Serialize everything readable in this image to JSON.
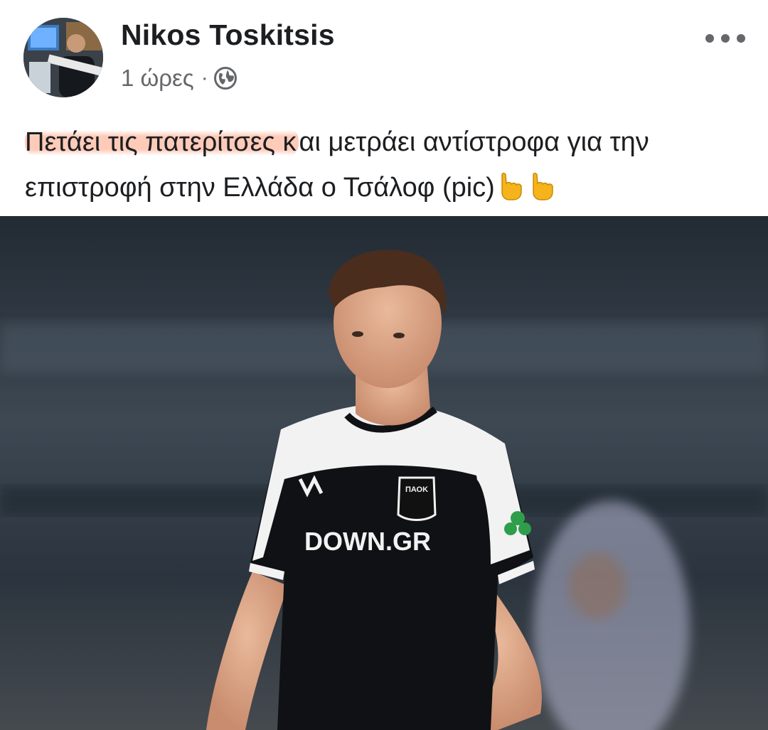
{
  "post": {
    "author": "Nikos Toskitsis",
    "timestamp": "1 ώρες",
    "separator": "·",
    "privacy_icon": "globe-icon",
    "more_icon": "more-dots-icon",
    "text_highlighted": "Πετάει τις πατερίτσες κ",
    "text_rest_line1": "αι μετράει αντίστροφα για την",
    "text_line2": "επιστροφή στην Ελλάδα ο Τσάλοφ (pic)",
    "emoji": "👇 👇"
  },
  "photo": {
    "jersey_sponsor": "DOWN.GR",
    "crest_label": "ΠΑΟΚ"
  },
  "colors": {
    "name": "#1c1e21",
    "secondary": "#65676b",
    "highlight": "#ff8c64",
    "jersey": "#101114"
  }
}
